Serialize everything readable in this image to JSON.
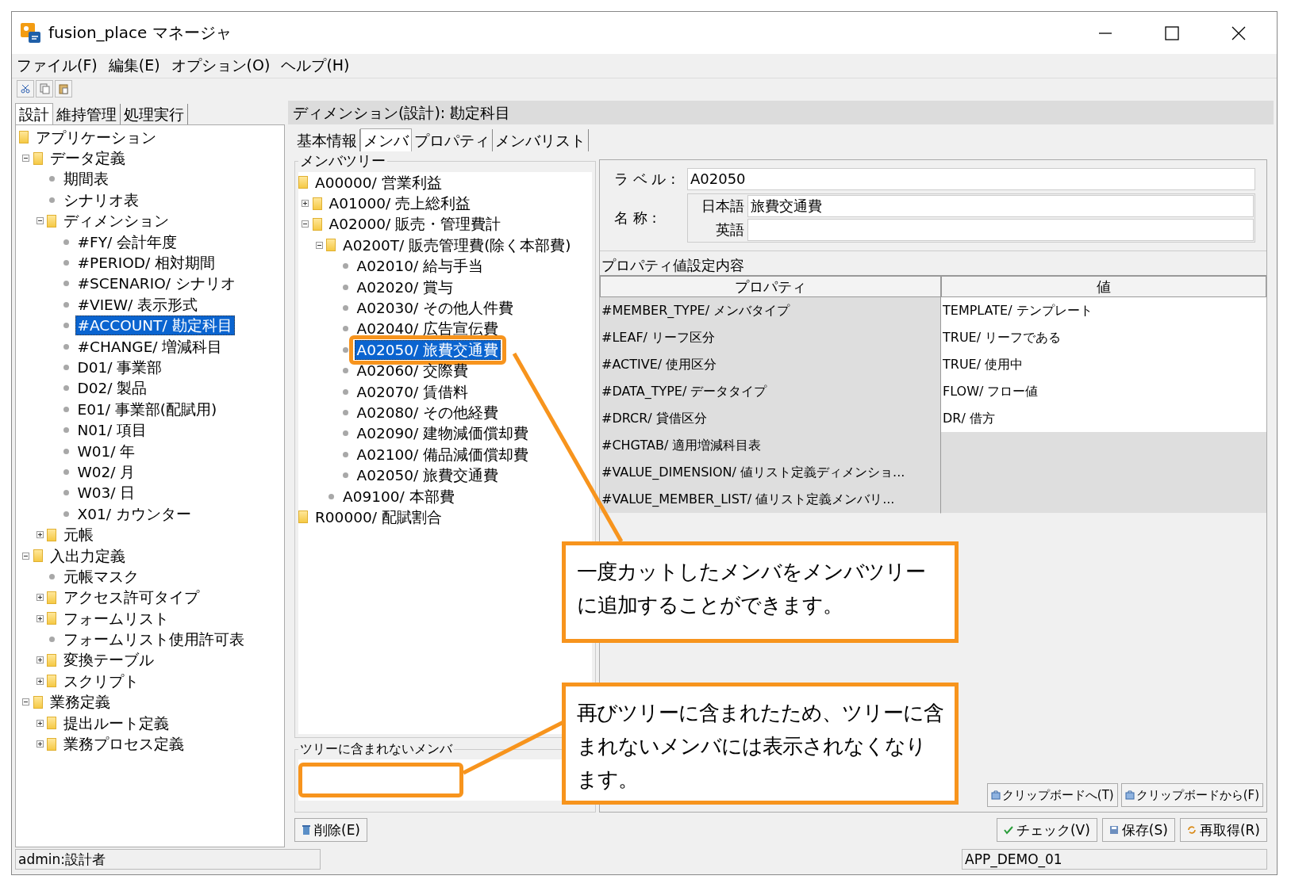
{
  "window": {
    "title": "fusion_place マネージャ"
  },
  "menu": [
    "ファイル(F)",
    "編集(E)",
    "オプション(O)",
    "ヘルプ(H)"
  ],
  "sidebar": {
    "tabs": [
      {
        "label": "設計",
        "selected": true
      },
      {
        "label": "維持管理",
        "selected": false
      },
      {
        "label": "処理実行",
        "selected": false
      }
    ],
    "tree": [
      {
        "label": "アプリケーション",
        "kind": "folder",
        "selected": false,
        "children": [
          {
            "label": "データ定義",
            "kind": "folder",
            "expanded": true,
            "selected": false,
            "children": [
              {
                "label": "期間表",
                "kind": "leaf",
                "selected": false
              },
              {
                "label": "シナリオ表",
                "kind": "leaf",
                "selected": false
              },
              {
                "label": "ディメンション",
                "kind": "folder",
                "expanded": true,
                "selected": false,
                "children": [
                  {
                    "label": "#FY/ 会計年度",
                    "kind": "leaf",
                    "selected": false
                  },
                  {
                    "label": "#PERIOD/ 相対期間",
                    "kind": "leaf",
                    "selected": false
                  },
                  {
                    "label": "#SCENARIO/ シナリオ",
                    "kind": "leaf",
                    "selected": false
                  },
                  {
                    "label": "#VIEW/ 表示形式",
                    "kind": "leaf",
                    "selected": false
                  },
                  {
                    "label": "#ACCOUNT/ 勘定科目",
                    "kind": "leaf",
                    "selected": true
                  },
                  {
                    "label": "#CHANGE/ 増減科目",
                    "kind": "leaf",
                    "selected": false
                  },
                  {
                    "label": "D01/ 事業部",
                    "kind": "leaf",
                    "selected": false
                  },
                  {
                    "label": "D02/ 製品",
                    "kind": "leaf",
                    "selected": false
                  },
                  {
                    "label": "E01/ 事業部(配賦用)",
                    "kind": "leaf",
                    "selected": false
                  },
                  {
                    "label": "N01/ 項目",
                    "kind": "leaf",
                    "selected": false
                  },
                  {
                    "label": "W01/ 年",
                    "kind": "leaf",
                    "selected": false
                  },
                  {
                    "label": "W02/ 月",
                    "kind": "leaf",
                    "selected": false
                  },
                  {
                    "label": "W03/ 日",
                    "kind": "leaf",
                    "selected": false
                  },
                  {
                    "label": "X01/ カウンター",
                    "kind": "leaf",
                    "selected": false
                  }
                ]
              },
              {
                "label": "元帳",
                "kind": "folder",
                "expanded": false,
                "selected": false
              }
            ]
          },
          {
            "label": "入出力定義",
            "kind": "folder",
            "expanded": true,
            "selected": false,
            "children": [
              {
                "label": "元帳マスク",
                "kind": "leaf",
                "selected": false
              },
              {
                "label": "アクセス許可タイプ",
                "kind": "folder",
                "expanded": false,
                "selected": false
              },
              {
                "label": "フォームリスト",
                "kind": "folder",
                "expanded": false,
                "selected": false
              },
              {
                "label": "フォームリスト使用許可表",
                "kind": "leaf",
                "selected": false
              },
              {
                "label": "変換テーブル",
                "kind": "folder",
                "expanded": false,
                "selected": false
              },
              {
                "label": "スクリプト",
                "kind": "folder",
                "expanded": false,
                "selected": false
              }
            ]
          },
          {
            "label": "業務定義",
            "kind": "folder",
            "expanded": true,
            "selected": false,
            "children": [
              {
                "label": "提出ルート定義",
                "kind": "folder",
                "expanded": false,
                "selected": false
              },
              {
                "label": "業務プロセス定義",
                "kind": "folder",
                "expanded": false,
                "selected": false
              }
            ]
          }
        ]
      }
    ]
  },
  "panel": {
    "title": "ディメンション(設計): 勘定科目",
    "tabs": [
      {
        "label": "基本情報",
        "selected": false
      },
      {
        "label": "メンバ",
        "selected": true
      },
      {
        "label": "プロパティ",
        "selected": false
      },
      {
        "label": "メンバリスト",
        "selected": false
      }
    ],
    "member_tree": {
      "title": "メンバツリー",
      "nodes": [
        {
          "label": "A00000/ 営業利益",
          "kind": "folder",
          "selected": false,
          "children": [
            {
              "label": "A01000/ 売上総利益",
              "kind": "folder",
              "expanded": false,
              "selected": false
            },
            {
              "label": "A02000/ 販売・管理費計",
              "kind": "folder",
              "expanded": true,
              "selected": false,
              "children": [
                {
                  "label": "A0200T/ 販売管理費(除く本部費)",
                  "kind": "folder",
                  "expanded": true,
                  "selected": false,
                  "children": [
                    {
                      "label": "A02010/ 給与手当",
                      "kind": "leaf",
                      "selected": false
                    },
                    {
                      "label": "A02020/ 賞与",
                      "kind": "leaf",
                      "selected": false
                    },
                    {
                      "label": "A02030/ その他人件費",
                      "kind": "leaf",
                      "selected": false
                    },
                    {
                      "label": "A02040/ 広告宣伝費",
                      "kind": "leaf",
                      "selected": false
                    },
                    {
                      "label": "A02050/ 旅費交通費",
                      "kind": "leaf",
                      "selected": true,
                      "highlighted": true
                    },
                    {
                      "label": "A02060/ 交際費",
                      "kind": "leaf",
                      "selected": false
                    },
                    {
                      "label": "A02070/ 賃借料",
                      "kind": "leaf",
                      "selected": false
                    },
                    {
                      "label": "A02080/ その他経費",
                      "kind": "leaf",
                      "selected": false
                    },
                    {
                      "label": "A02090/ 建物減価償却費",
                      "kind": "leaf",
                      "selected": false
                    },
                    {
                      "label": "A02100/ 備品減価償却費",
                      "kind": "leaf",
                      "selected": false
                    },
                    {
                      "label": "A02050/ 旅費交通費",
                      "kind": "leaf",
                      "selected": false
                    }
                  ]
                },
                {
                  "label": "A09100/ 本部費",
                  "kind": "leaf",
                  "selected": false
                }
              ]
            }
          ]
        },
        {
          "label": "R00000/ 配賦割合",
          "kind": "folder",
          "selected": false
        }
      ]
    },
    "not_in_tree": {
      "title": "ツリーに含まれないメンバ",
      "highlighted": true
    },
    "fields": {
      "label_caption": "ラ ベ ル :",
      "label_value": "A02050",
      "name_caption": "名 称 :",
      "japanese_caption": "日本語",
      "japanese_value": "旅費交通費",
      "english_caption": "英語"
    },
    "properties": {
      "title": "プロパティ値設定内容",
      "columns": [
        "プロパティ",
        "値"
      ],
      "rows": [
        [
          "#MEMBER_TYPE/ メンバタイプ",
          "TEMPLATE/ テンプレート"
        ],
        [
          "#LEAF/ リーフ区分",
          "TRUE/ リーフである"
        ],
        [
          "#ACTIVE/ 使用区分",
          "TRUE/ 使用中"
        ],
        [
          "#DATA_TYPE/ データタイプ",
          "FLOW/ フロー値"
        ],
        [
          "#DRCR/ 貸借区分",
          "DR/ 借方"
        ],
        [
          "#CHGTAB/ 適用増減科目表",
          ""
        ],
        [
          "#VALUE_DIMENSION/ 値リスト定義ディメンショ...",
          ""
        ],
        [
          "#VALUE_MEMBER_LIST/ 値リスト定義メンバリ...",
          ""
        ]
      ]
    },
    "clipboard_buttons": [
      "クリップボードへ(T)",
      "クリップボードから(F)"
    ],
    "delete_button": "削除(E)",
    "action_buttons": [
      "チェック(V)",
      "保存(S)",
      "再取得(R)"
    ]
  },
  "status_bar": {
    "user": "admin:設計者",
    "application": "APP_DEMO_01"
  },
  "callouts": [
    "一度カットしたメンバをメンバツリーに追加することができます。",
    "再びツリーに含まれたため、ツリーに含まれないメンバには表示されなくなります。"
  ]
}
